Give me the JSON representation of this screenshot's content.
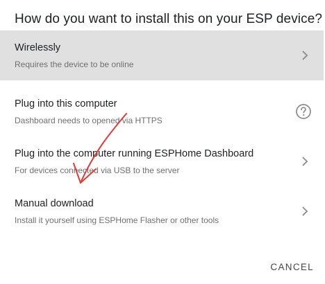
{
  "dialog": {
    "title": "How do you want to install this on your ESP device?",
    "options": [
      {
        "label": "Wirelessly",
        "description": "Requires the device to be online",
        "icon": "chevron-right-icon",
        "selected": true
      },
      {
        "label": "Plug into this computer",
        "description": "Dashboard needs to opened via HTTPS",
        "icon": "help-circle-icon"
      },
      {
        "label": "Plug into the computer running ESPHome Dashboard",
        "description": "For devices connected via USB to the server",
        "icon": "chevron-right-icon"
      },
      {
        "label": "Manual download",
        "description": "Install it yourself using ESPHome Flasher or other tools",
        "icon": "chevron-right-icon"
      }
    ],
    "cancel_label": "CANCEL"
  },
  "colors": {
    "selected_background": "#e0e0e0",
    "annotation_arrow": "#e53935",
    "icon": "#8a8a8a"
  }
}
